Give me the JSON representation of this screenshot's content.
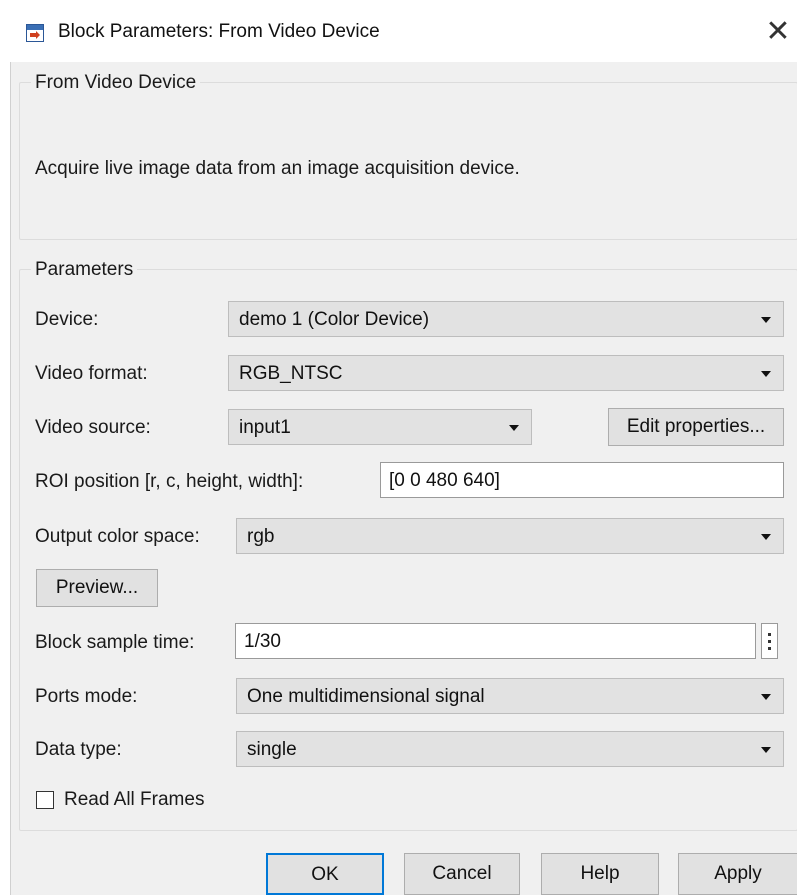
{
  "window": {
    "title": "Block Parameters: From Video Device",
    "close_glyph": "✕"
  },
  "description_group": {
    "title": "From Video Device",
    "text": "Acquire live image data from an image acquisition device."
  },
  "parameters_group": {
    "title": "Parameters",
    "device": {
      "label": "Device:",
      "value": "demo 1 (Color Device)"
    },
    "video_format": {
      "label": "Video format:",
      "value": "RGB_NTSC"
    },
    "video_source": {
      "label": "Video source:",
      "value": "input1"
    },
    "edit_properties_label": "Edit properties...",
    "roi_position": {
      "label": "ROI position [r, c, height, width]:",
      "value": "[0 0 480 640]"
    },
    "output_color_space": {
      "label": "Output color space:",
      "value": "rgb"
    },
    "preview_label": "Preview...",
    "block_sample_time": {
      "label": "Block sample time:",
      "value": "1/30"
    },
    "ports_mode": {
      "label": "Ports mode:",
      "value": "One multidimensional signal"
    },
    "data_type": {
      "label": "Data type:",
      "value": "single"
    },
    "read_all_frames": {
      "label": "Read All Frames",
      "checked": false
    }
  },
  "buttons": {
    "ok": "OK",
    "cancel": "Cancel",
    "help": "Help",
    "apply": "Apply"
  },
  "colors": {
    "dialog_bg": "#f0f0f0",
    "combo_bg": "#e2e2e2",
    "focus_border": "#0078d7"
  }
}
